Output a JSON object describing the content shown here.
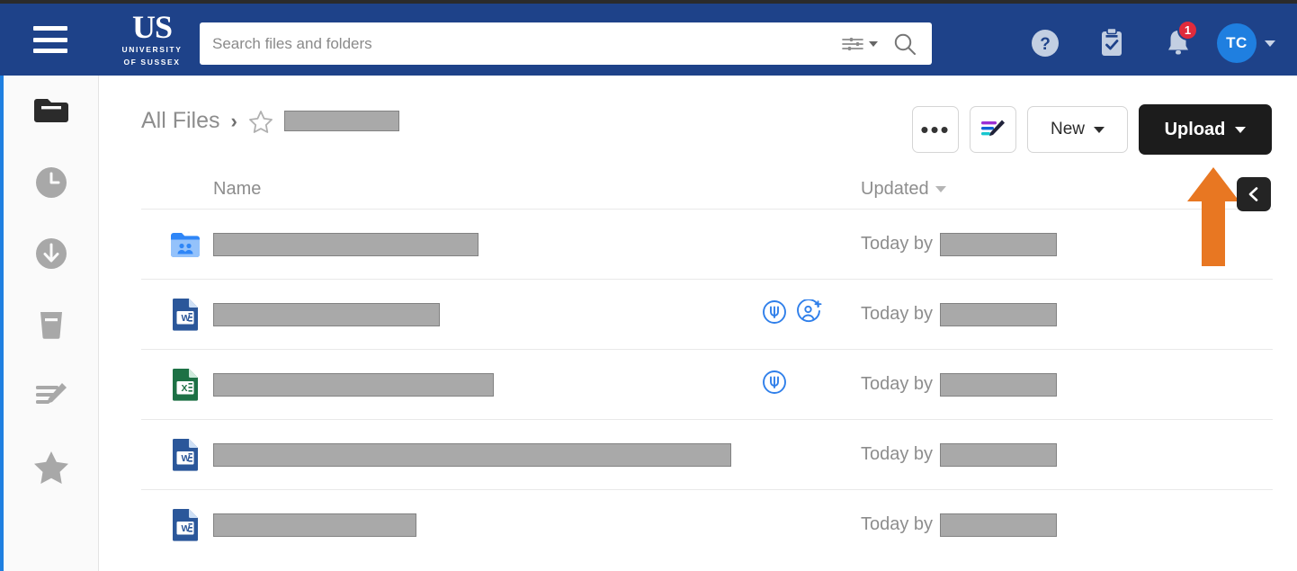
{
  "header": {
    "menu_icon": "hamburger-icon",
    "logo": {
      "mark": "US",
      "line1": "UNIVERSITY",
      "line2": "OF SUSSEX"
    },
    "search": {
      "placeholder": "Search files and folders",
      "value": ""
    },
    "icons": [
      {
        "name": "help-icon",
        "glyph": "?"
      },
      {
        "name": "tasks-clipboard-icon",
        "glyph": "clipboard-check"
      },
      {
        "name": "notifications-bell-icon",
        "glyph": "bell",
        "badge": "1"
      }
    ],
    "avatar": {
      "initials": "TC"
    },
    "colors": {
      "header_bg": "#1e4289",
      "accent_blue": "#1f7fe0",
      "badge_red": "#e02b3c"
    }
  },
  "sidebar": {
    "items": [
      {
        "name": "sidebar-item-all-files",
        "icon": "folder-icon",
        "active": true
      },
      {
        "name": "sidebar-item-recents",
        "icon": "clock-icon",
        "active": false
      },
      {
        "name": "sidebar-item-synced",
        "icon": "download-circle-icon",
        "active": false
      },
      {
        "name": "sidebar-item-trash",
        "icon": "trash-icon",
        "active": false
      },
      {
        "name": "sidebar-item-notes",
        "icon": "notes-pencil-icon",
        "active": false
      },
      {
        "name": "sidebar-item-favorites",
        "icon": "star-icon",
        "active": false
      }
    ]
  },
  "breadcrumb": {
    "root_label": "All Files",
    "separator": "›",
    "favorite_icon": "star-outline-icon",
    "current_redacted": true,
    "current_width": 128
  },
  "toolbar": {
    "more_label": "•••",
    "notes_icon": "note-edit-icon",
    "new_label": "New",
    "upload_label": "Upload",
    "collapse_icon": "chevron-left-icon",
    "annotation": {
      "type": "arrow-up",
      "color": "#e87722",
      "points_to": "upload-button"
    }
  },
  "table": {
    "columns": {
      "name": "Name",
      "updated": "Updated"
    },
    "sort_indicator": "chevron-down-icon",
    "rows": [
      {
        "icon": "shared-folder-icon",
        "name_width": 295,
        "badges": [],
        "updated_prefix": "Today by",
        "updated_width": 130
      },
      {
        "icon": "word-file-icon",
        "name_width": 252,
        "badges": [
          "classification-lock-icon",
          "add-collaborator-icon"
        ],
        "updated_prefix": "Today by",
        "updated_width": 130
      },
      {
        "icon": "excel-file-icon",
        "name_width": 312,
        "badges": [
          "classification-lock-icon"
        ],
        "updated_prefix": "Today by",
        "updated_width": 130
      },
      {
        "icon": "word-file-icon",
        "name_width": 576,
        "badges": [],
        "updated_prefix": "Today by",
        "updated_width": 130
      },
      {
        "icon": "word-file-icon",
        "name_width": 226,
        "badges": [],
        "updated_prefix": "Today by",
        "updated_width": 130
      }
    ]
  }
}
